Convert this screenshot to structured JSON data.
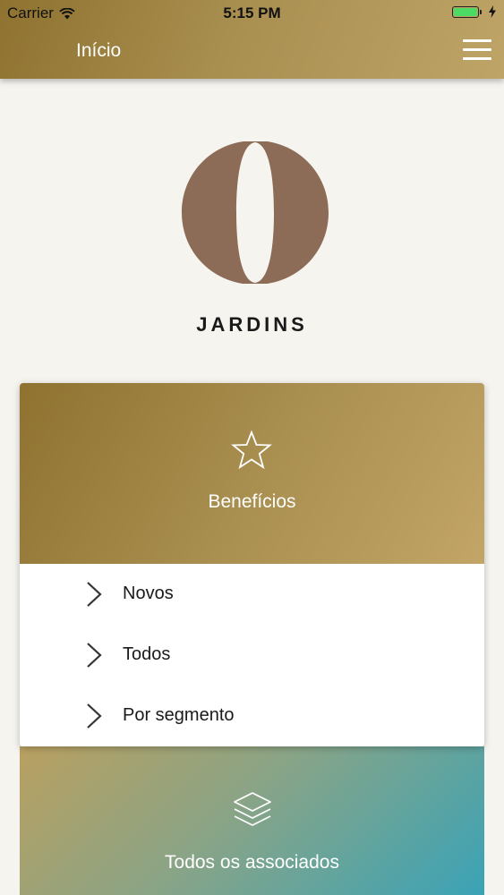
{
  "status_bar": {
    "carrier": "Carrier",
    "time": "5:15 PM",
    "battery_level": 1.0
  },
  "nav": {
    "title": "Início",
    "menu_icon": "hamburger-menu-icon"
  },
  "brand": {
    "logo_icon": "o-logo",
    "name": "JARDINS",
    "logo_color": "#8c6b57"
  },
  "benefits_card": {
    "icon": "star-icon",
    "title": "Benefícios",
    "items": [
      {
        "label": "Novos",
        "icon": "chevron-right-icon"
      },
      {
        "label": "Todos",
        "icon": "chevron-right-icon"
      },
      {
        "label": "Por segmento",
        "icon": "chevron-right-icon"
      }
    ]
  },
  "associates_card": {
    "icon": "layers-icon",
    "title": "Todos os associados"
  },
  "colors": {
    "gold_start": "#8f7230",
    "gold_end": "#c2a567",
    "teal": "#3aa3b6",
    "background": "#f6f4ef"
  }
}
